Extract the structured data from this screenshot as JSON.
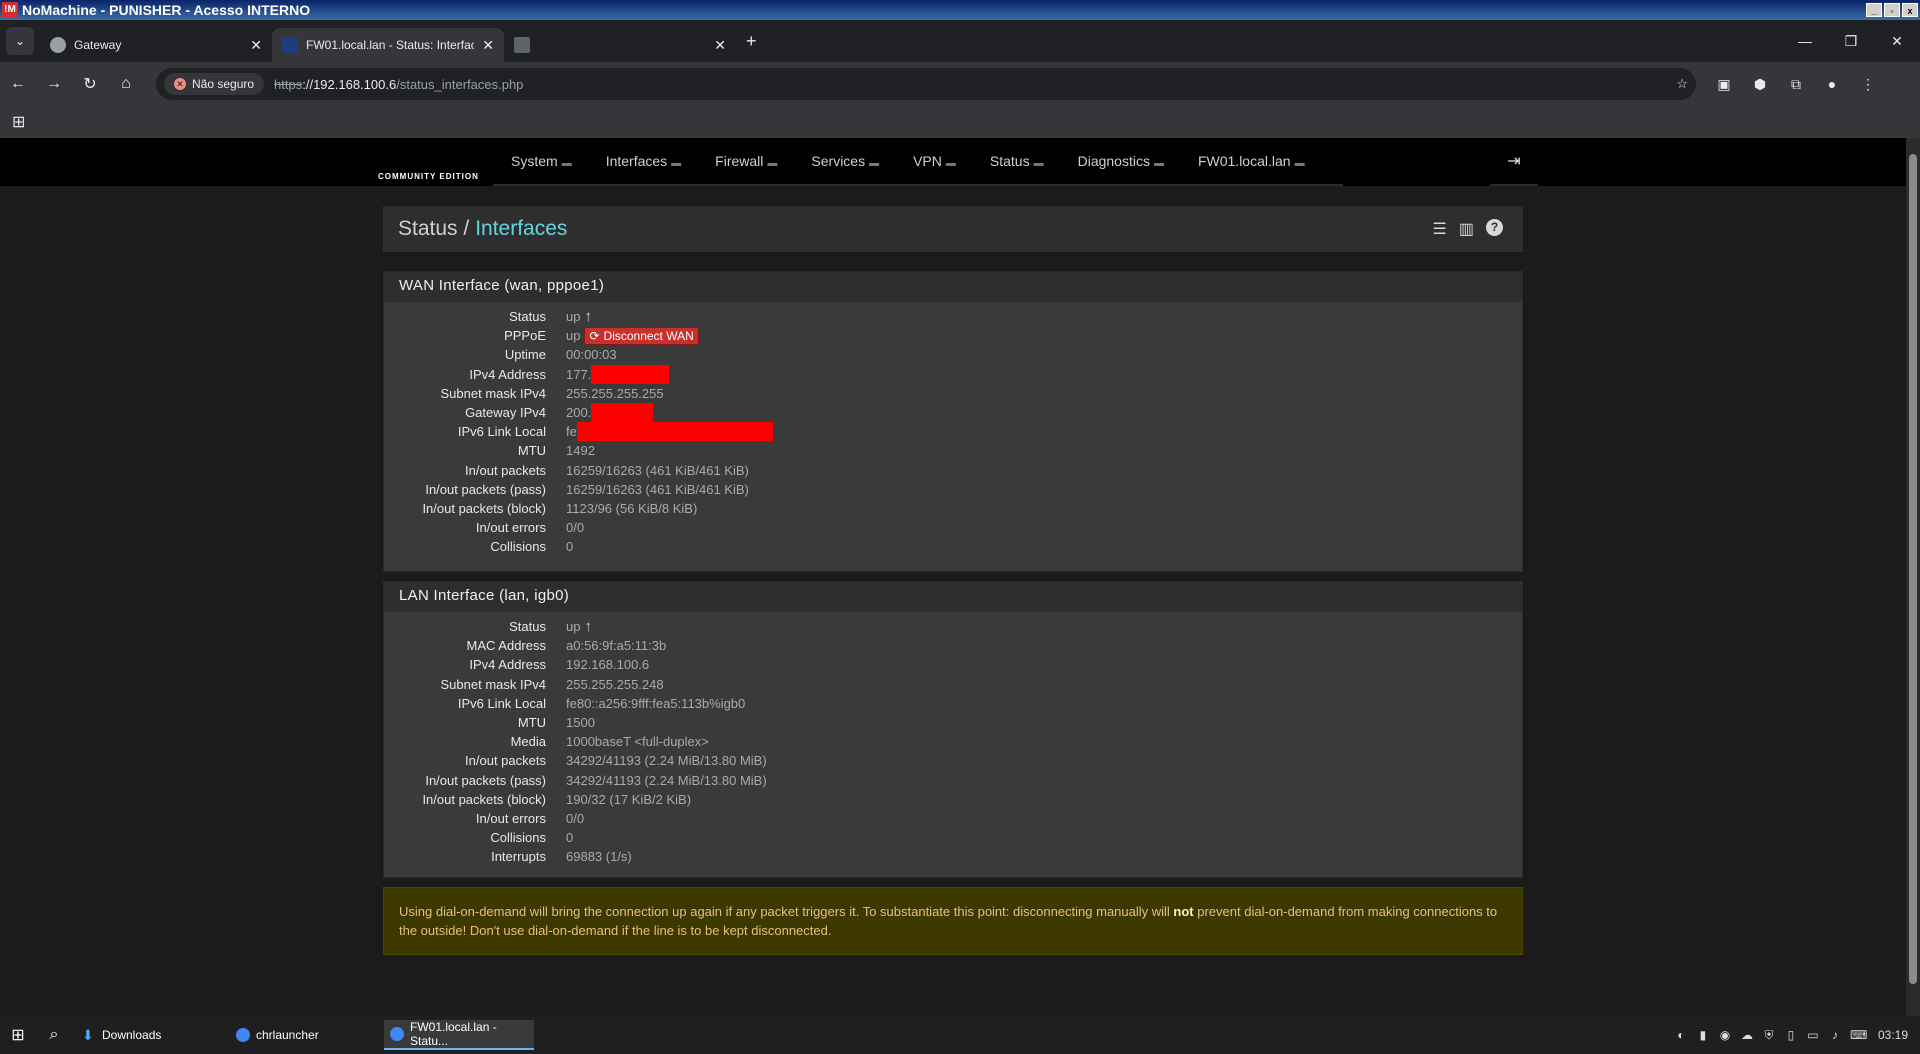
{
  "window": {
    "title": "NoMachine - PUNISHER - Acesso INTERNO"
  },
  "browser": {
    "tabs": [
      {
        "title": "Gateway"
      },
      {
        "title": "FW01.local.lan - Status: Interfac",
        "active": true
      },
      {
        "title": ""
      }
    ],
    "security_label": "Não seguro",
    "url_scheme": "https",
    "url_host": "://192.168.100.6",
    "url_path": "/status_interfaces.php",
    "extension_badge": "1"
  },
  "pfsense": {
    "brand": "COMMUNITY EDITION",
    "menu": [
      "System",
      "Interfaces",
      "Firewall",
      "Services",
      "VPN",
      "Status",
      "Diagnostics",
      "FW01.local.lan"
    ],
    "breadcrumb_root": "Status /",
    "breadcrumb_page": "Interfaces",
    "wan": {
      "title": "WAN Interface (wan, pppoe1)",
      "status_label": "Status",
      "status_value": "up",
      "pppoe_label": "PPPoE",
      "pppoe_value": "up",
      "disconnect_label": "Disconnect WAN",
      "uptime_label": "Uptime",
      "uptime_value": "00:00:03",
      "ipv4_label": "IPv4 Address",
      "ipv4_prefix": "177.",
      "subnet_label": "Subnet mask IPv4",
      "subnet_value": "255.255.255.255",
      "gateway_label": "Gateway IPv4",
      "gateway_prefix": "200.",
      "ipv6ll_label": "IPv6 Link Local",
      "ipv6ll_prefix": "fe",
      "mtu_label": "MTU",
      "mtu_value": "1492",
      "inout_label": "In/out packets",
      "inout_value": "16259/16263 (461 KiB/461 KiB)",
      "inout_pass_label": "In/out packets (pass)",
      "inout_pass_value": "16259/16263 (461 KiB/461 KiB)",
      "inout_block_label": "In/out packets (block)",
      "inout_block_value": "1123/96 (56 KiB/8 KiB)",
      "errors_label": "In/out errors",
      "errors_value": "0/0",
      "collisions_label": "Collisions",
      "collisions_value": "0"
    },
    "lan": {
      "title": "LAN Interface (lan, igb0)",
      "status_label": "Status",
      "status_value": "up",
      "mac_label": "MAC Address",
      "mac_value": "a0:56:9f:a5:11:3b",
      "ipv4_label": "IPv4 Address",
      "ipv4_value": "192.168.100.6",
      "subnet_label": "Subnet mask IPv4",
      "subnet_value": "255.255.255.248",
      "ipv6ll_label": "IPv6 Link Local",
      "ipv6ll_value": "fe80::a256:9fff:fea5:113b%igb0",
      "mtu_label": "MTU",
      "mtu_value": "1500",
      "media_label": "Media",
      "media_value": "1000baseT <full-duplex>",
      "inout_label": "In/out packets",
      "inout_value": "34292/41193 (2.24 MiB/13.80 MiB)",
      "inout_pass_label": "In/out packets (pass)",
      "inout_pass_value": "34292/41193 (2.24 MiB/13.80 MiB)",
      "inout_block_label": "In/out packets (block)",
      "inout_block_value": "190/32 (17 KiB/2 KiB)",
      "errors_label": "In/out errors",
      "errors_value": "0/0",
      "collisions_label": "Collisions",
      "collisions_value": "0",
      "interrupts_label": "Interrupts",
      "interrupts_value": "69883 (1/s)"
    },
    "warning": {
      "text_before": "Using dial-on-demand will bring the connection up again if any packet triggers it. To substantiate this point: disconnecting manually will ",
      "text_bold": "not",
      "text_after": " prevent dial-on-demand from making connections to the outside! Don't use dial-on-demand if the line is to be kept disconnected."
    }
  },
  "taskbar": {
    "apps": [
      "Downloads",
      "chrlauncher",
      "FW01.local.lan - Statu..."
    ],
    "clock": "03:19"
  },
  "colors": {
    "accent_link": "#61d5e0",
    "danger": "#c9302c",
    "redaction": "#ff0000",
    "warning_bg": "#3d3800"
  }
}
